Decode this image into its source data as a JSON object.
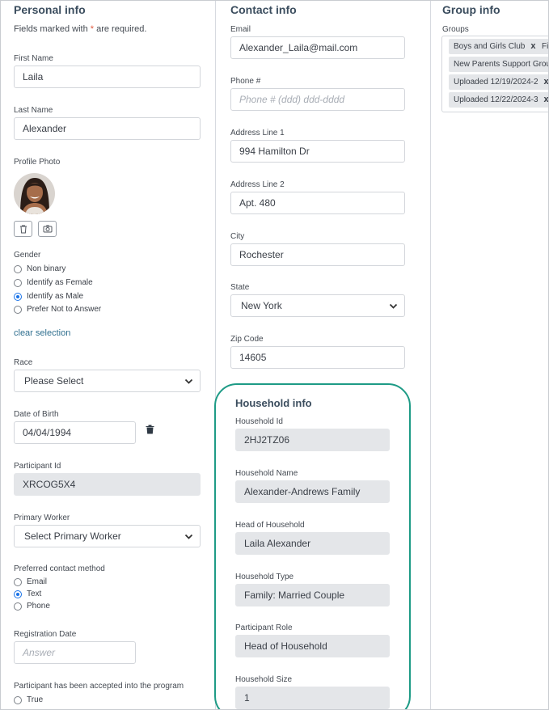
{
  "personal": {
    "title": "Personal info",
    "required_note_prefix": "Fields marked with ",
    "required_star": "*",
    "required_note_suffix": " are required.",
    "first_name_label": "First Name",
    "first_name_value": "Laila",
    "last_name_label": "Last Name",
    "last_name_value": "Alexander",
    "profile_photo_label": "Profile Photo",
    "gender_label": "Gender",
    "gender_options": [
      "Non binary",
      "Identify as Female",
      "Identify as Male",
      "Prefer Not to Answer"
    ],
    "gender_selected": "Identify as Male",
    "clear_selection": "clear selection",
    "race_label": "Race",
    "race_value": "Please Select",
    "dob_label": "Date of Birth",
    "dob_value": "04/04/1994",
    "participant_id_label": "Participant Id",
    "participant_id_value": "XRCOG5X4",
    "primary_worker_label": "Primary Worker",
    "primary_worker_value": "Select Primary Worker",
    "contact_method_label": "Preferred contact method",
    "contact_options": [
      "Email",
      "Text",
      "Phone"
    ],
    "contact_selected": "Text",
    "registration_label": "Registration Date",
    "registration_placeholder": "Answer",
    "accepted_label": "Participant has been accepted into the program",
    "accepted_options": [
      "True"
    ]
  },
  "contact": {
    "title": "Contact info",
    "email_label": "Email",
    "email_value": "Alexander_Laila@mail.com",
    "phone_label": "Phone #",
    "phone_placeholder": "Phone # (ddd) ddd-dddd",
    "address1_label": "Address Line 1",
    "address1_value": "994 Hamilton Dr",
    "address2_label": "Address Line 2",
    "address2_value": "Apt. 480",
    "city_label": "City",
    "city_value": "Rochester",
    "state_label": "State",
    "state_value": "New York",
    "zip_label": "Zip Code",
    "zip_value": "14605"
  },
  "household": {
    "title": "Household info",
    "id_label": "Household Id",
    "id_value": "2HJ2TZ06",
    "name_label": "Household Name",
    "name_value": "Alexander-Andrews Family",
    "head_label": "Head of Household",
    "head_value": "Laila Alexander",
    "type_label": "Household Type",
    "type_value": "Family: Married Couple",
    "role_label": "Participant Role",
    "role_value": "Head of Household",
    "size_label": "Household Size",
    "size_value": "1"
  },
  "group": {
    "title": "Group info",
    "groups_label": "Groups",
    "tags": [
      "Boys and Girls Club",
      "Fi",
      "New Parents Support Group",
      "Uploaded 12/19/2024-2",
      "Uploaded 12/22/2024-3"
    ],
    "remove_glyph": "x"
  },
  "colors": {
    "accent": "#1e9b86",
    "link": "#2f6f8f",
    "radio_selected": "#1a73e8",
    "required": "#e05a3f"
  }
}
